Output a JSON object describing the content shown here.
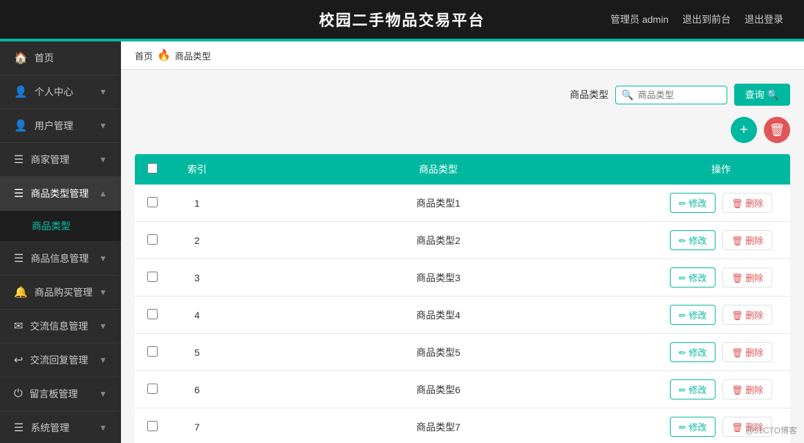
{
  "header": {
    "title": "校园二手物品交易平台",
    "admin_label": "管理员 admin",
    "goto_front": "退出到前台",
    "logout": "退出登录"
  },
  "breadcrumb": {
    "home": "首页",
    "separator": "🔥",
    "current": "商品类型"
  },
  "search": {
    "label": "商品类型",
    "placeholder": "商品类型",
    "button_label": "查询",
    "search_icon": "🔍"
  },
  "buttons": {
    "add_label": "+",
    "delete_label": "🗑"
  },
  "table": {
    "columns": [
      "索引",
      "商品类型",
      "操作"
    ],
    "modify_label": "✏ 修改",
    "delete_label": "🗑 删除",
    "rows": [
      {
        "index": 1,
        "type": "商品类型1"
      },
      {
        "index": 2,
        "type": "商品类型2"
      },
      {
        "index": 3,
        "type": "商品类型3"
      },
      {
        "index": 4,
        "type": "商品类型4"
      },
      {
        "index": 5,
        "type": "商品类型5"
      },
      {
        "index": 6,
        "type": "商品类型6"
      },
      {
        "index": 7,
        "type": "商品类型7"
      }
    ]
  },
  "sidebar": {
    "items": [
      {
        "id": "home",
        "icon": "🏠",
        "label": "首页",
        "has_sub": false
      },
      {
        "id": "profile",
        "icon": "👤",
        "label": "个人中心",
        "has_sub": true
      },
      {
        "id": "user",
        "icon": "👥",
        "label": "用户管理",
        "has_sub": true
      },
      {
        "id": "merchant",
        "icon": "☰",
        "label": "商家管理",
        "has_sub": true
      },
      {
        "id": "category",
        "icon": "☰",
        "label": "商品类型管理",
        "has_sub": true,
        "active": true
      },
      {
        "id": "goods",
        "icon": "☰",
        "label": "商品信息管理",
        "has_sub": true
      },
      {
        "id": "purchase",
        "icon": "🔔",
        "label": "商品购买管理",
        "has_sub": true
      },
      {
        "id": "exchange",
        "icon": "✉",
        "label": "交流信息管理",
        "has_sub": true
      },
      {
        "id": "reply",
        "icon": "↩",
        "label": "交流回复管理",
        "has_sub": true
      },
      {
        "id": "board",
        "icon": "⏻",
        "label": "留言板管理",
        "has_sub": true
      },
      {
        "id": "system",
        "icon": "☰",
        "label": "系统管理",
        "has_sub": true
      }
    ],
    "sub_item": "商品类型"
  },
  "watermark": "@51CTO博客"
}
